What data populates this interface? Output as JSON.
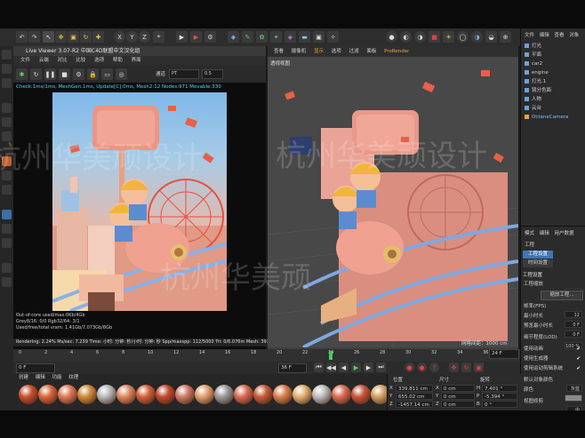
{
  "live_viewer": {
    "title": "Live Viewer 3.07-R2 中国C4D联盟中文汉化组",
    "menu": [
      "文件",
      "云端",
      "对比",
      "比较",
      "选项",
      "帮助",
      "界面"
    ],
    "channel_label": "通道",
    "channel_value": "PT",
    "zoom_value": "0.5",
    "status_line": "Check:1ms/1ms, MeshGen:1ms, Update[C]:0ms, Mesh2:12 Nodes:971 Movable:330",
    "info_lines": [
      "Out-of-core used/max:0Kb/4Gb",
      "Grey8/16: 0/0        Rgb32/64: 3/1",
      "Used/free/total vram: 1.41Gb/7.073Gb/8Gb"
    ],
    "bottom_status": "Rendering: 2.24%   Ms/sec: 7.239   Time: 小时: 分钟: 秒/小时: 分钟: 秒   Spp/maxspp: 112/5000   Tri: 0/6.076m   Mesh: 393   Hair"
  },
  "viewport": {
    "menu": [
      "查看",
      "摄像机",
      "显示",
      "选项",
      "过滤",
      "面板",
      "ProRender"
    ],
    "label": "透视视图",
    "grid_info": "网格间距：1000 cm"
  },
  "object_manager": {
    "menu": [
      "文件",
      "编辑",
      "查看",
      "对象"
    ],
    "objects": [
      "灯光",
      "平面",
      "car2",
      "engine",
      "灯光.1",
      "镜分色面",
      "人物",
      "云台",
      "OctaneCamera"
    ]
  },
  "attributes": {
    "menu": [
      "模式",
      "编辑",
      "用户数据"
    ],
    "section": "工程",
    "tabs": [
      "工程设置",
      "时间设置"
    ],
    "heading": "工程设置",
    "rows": [
      {
        "label": "工程缩放",
        "value": "1"
      },
      {
        "label": "帧率(FPS)",
        "value": "12"
      },
      {
        "label": "最小时长",
        "value": "0 F"
      },
      {
        "label": "预览最小时长",
        "value": "0 F"
      },
      {
        "label": "细节程度(LOD)",
        "value": "100 %"
      },
      {
        "label": "使用动画",
        "value": ""
      },
      {
        "label": "使用生成器",
        "value": ""
      },
      {
        "label": "使用运动剪辑系统",
        "value": ""
      },
      {
        "label": "默认对象颜色",
        "value": "灰蓝"
      },
      {
        "label": "颜色",
        "value": ""
      },
      {
        "label": "视图修剪",
        "value": "中"
      }
    ],
    "scale_button": "缩放工程..."
  },
  "timeline": {
    "ticks": [
      "0",
      "2",
      "4",
      "6",
      "8",
      "10",
      "12",
      "14",
      "16",
      "18",
      "20",
      "22",
      "24",
      "26",
      "28",
      "30",
      "32",
      "34",
      "36",
      "38"
    ],
    "current_frame": "0 F",
    "end_frame": "36 F",
    "max_frame": "24 F"
  },
  "materials": {
    "menu": [
      "创建",
      "编辑",
      "功能",
      "纹理"
    ],
    "balls": [
      "#c8502e",
      "#d8663c",
      "#e07858",
      "#cf8a3a",
      "#b8b8b8",
      "#e08860",
      "#d2623a",
      "#c24b2e",
      "#d07a66",
      "#e0a070",
      "#9a9a9a",
      "#d86c50",
      "#c65a3a",
      "#d88050",
      "#e4b070",
      "#bdbdbd",
      "#d86c52",
      "#c8563a",
      "#cfa060"
    ]
  },
  "coordinates": {
    "headers": [
      "位置",
      "尺寸",
      "旋转"
    ],
    "rows": [
      {
        "axis": "X",
        "pos": "339.811 cm",
        "size": "0 cm",
        "rot_axis": "H",
        "rot": "7.401 °"
      },
      {
        "axis": "Y",
        "pos": "655.02 cm",
        "size": "0 cm",
        "rot_axis": "P",
        "rot": "-5.394 °"
      },
      {
        "axis": "Z",
        "pos": "-1457.14 cm",
        "size": "0 cm",
        "rot_axis": "B",
        "rot": "0 °"
      }
    ]
  },
  "watermark": [
    "杭州华美顽设计",
    "杭州华美顽设计",
    "杭州华美顽"
  ],
  "colors": {
    "status_cyan": "#4dd2ff",
    "active_tab": "#3d76b3",
    "playhead": "#40d060"
  }
}
